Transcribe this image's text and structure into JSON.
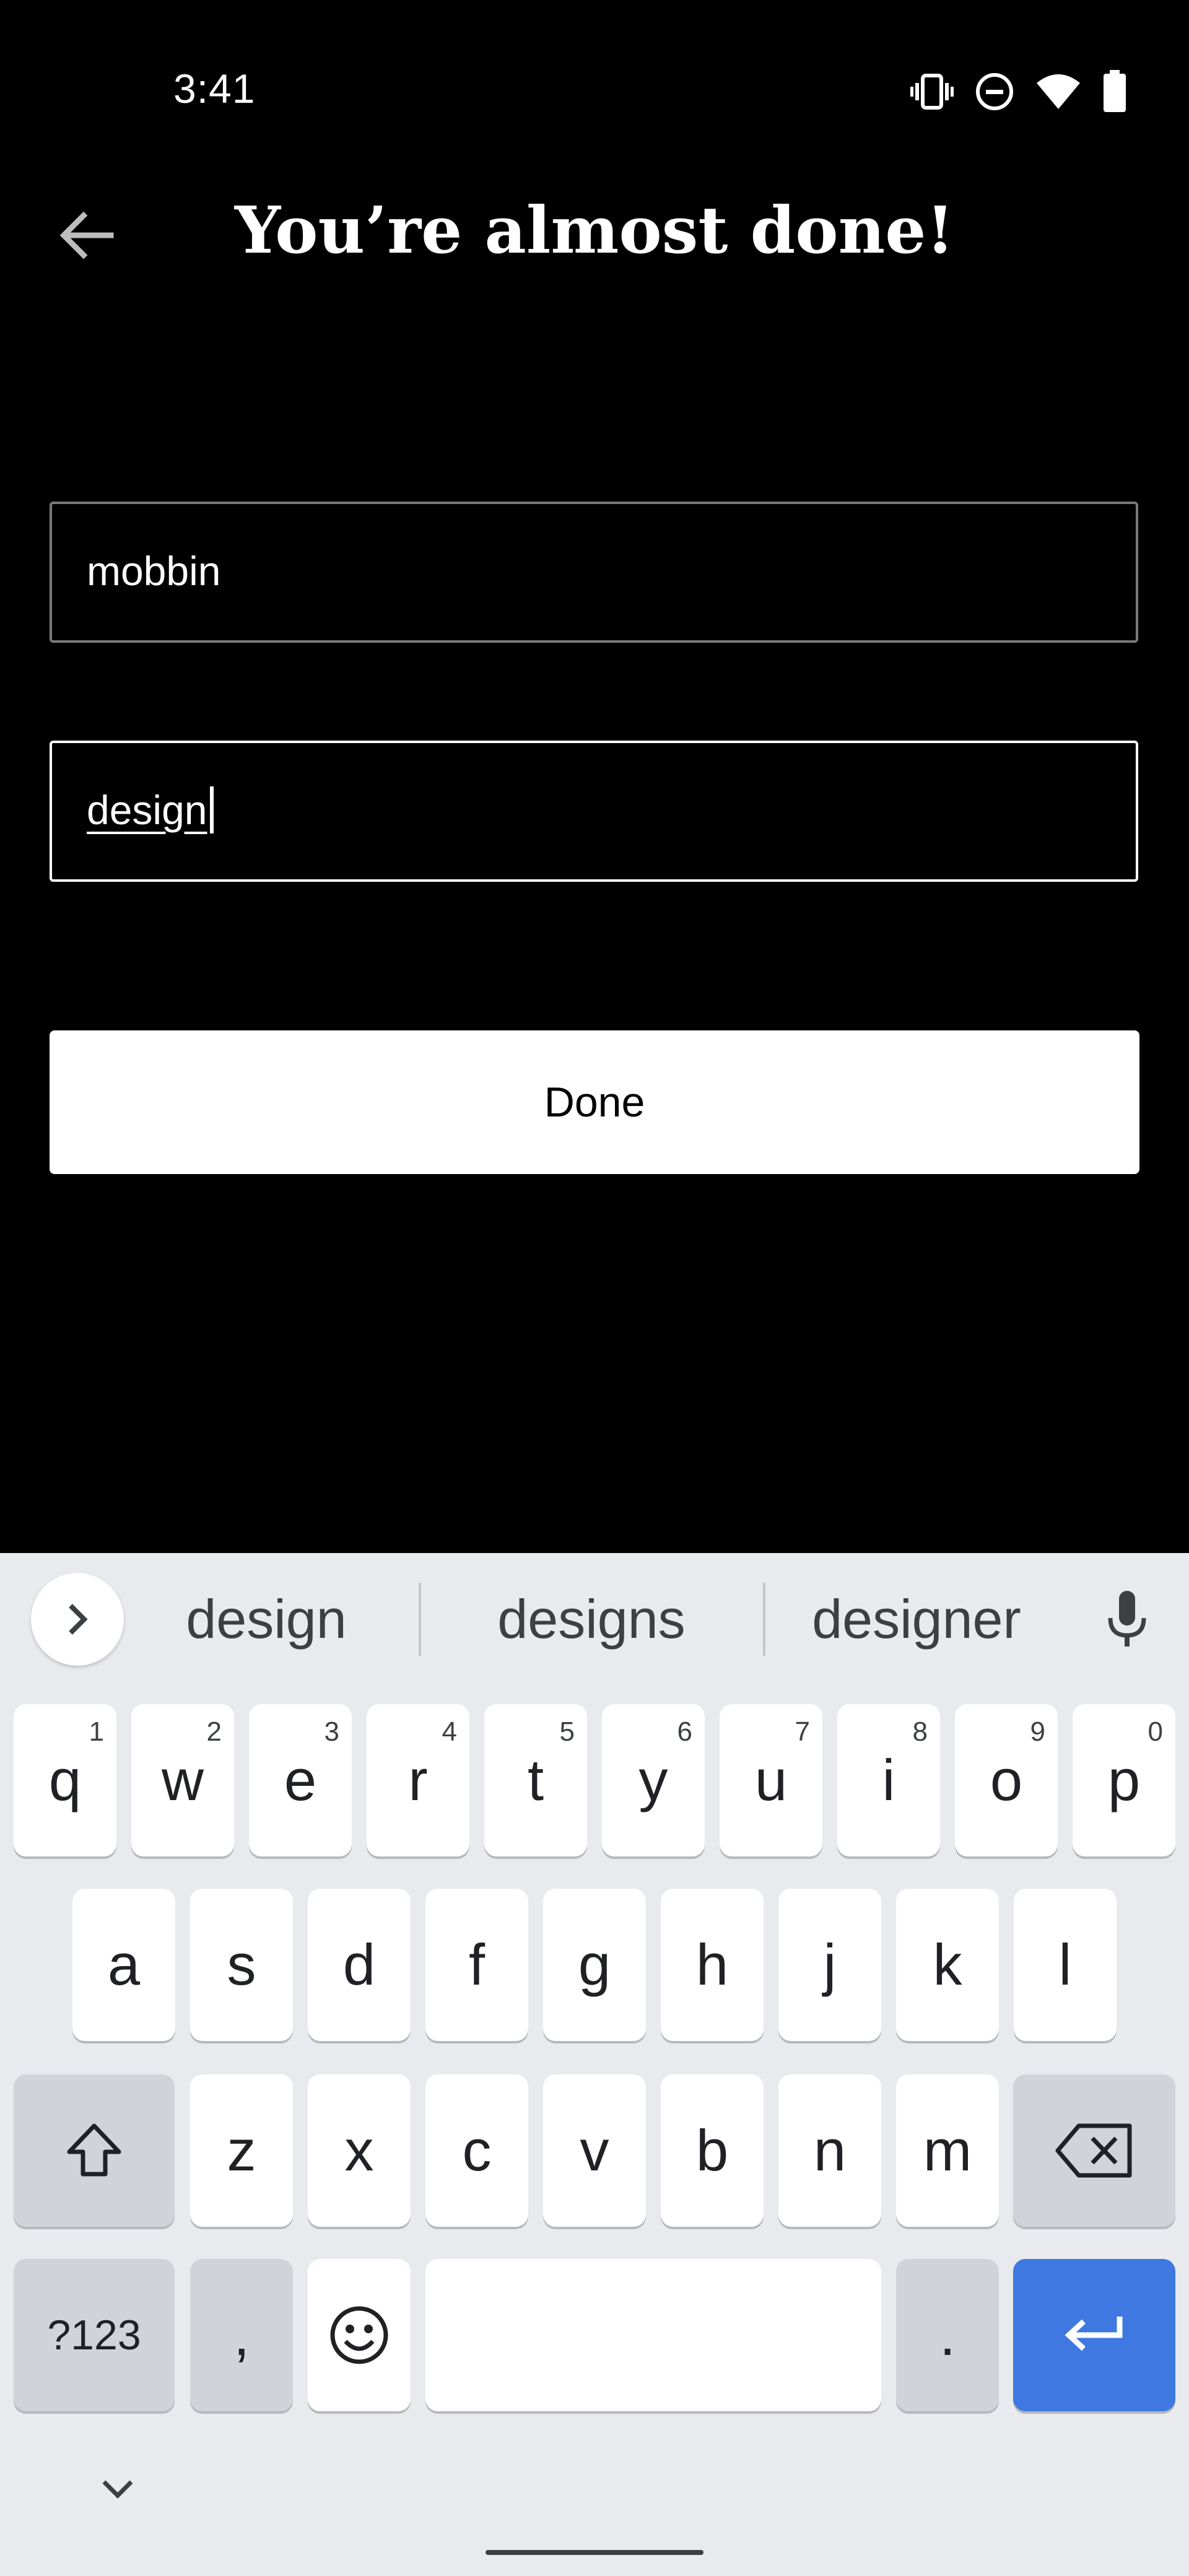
{
  "status_bar": {
    "time": "3:41",
    "icons": [
      "vibrate-icon",
      "do-not-disturb-icon",
      "wifi-icon",
      "battery-icon"
    ]
  },
  "header": {
    "title": "You’re almost done!",
    "back_icon": "arrow-left-icon"
  },
  "form": {
    "username_value": "mobbin",
    "password_value": "design",
    "done_label": "Done"
  },
  "keyboard": {
    "suggestions": [
      "design",
      "designs",
      "designer"
    ],
    "row1": [
      {
        "label": "q",
        "hint": "1"
      },
      {
        "label": "w",
        "hint": "2"
      },
      {
        "label": "e",
        "hint": "3"
      },
      {
        "label": "r",
        "hint": "4"
      },
      {
        "label": "t",
        "hint": "5"
      },
      {
        "label": "y",
        "hint": "6"
      },
      {
        "label": "u",
        "hint": "7"
      },
      {
        "label": "i",
        "hint": "8"
      },
      {
        "label": "o",
        "hint": "9"
      },
      {
        "label": "p",
        "hint": "0"
      }
    ],
    "row2": [
      "a",
      "s",
      "d",
      "f",
      "g",
      "h",
      "j",
      "k",
      "l"
    ],
    "row3": [
      "z",
      "x",
      "c",
      "v",
      "b",
      "n",
      "m"
    ],
    "symbols_label": "?123",
    "comma_label": ",",
    "period_label": ".",
    "colors": {
      "background": "#e8eaed",
      "key": "#ffffff",
      "key_dark": "#d0d3d7",
      "enter": "#3e78e0"
    }
  }
}
